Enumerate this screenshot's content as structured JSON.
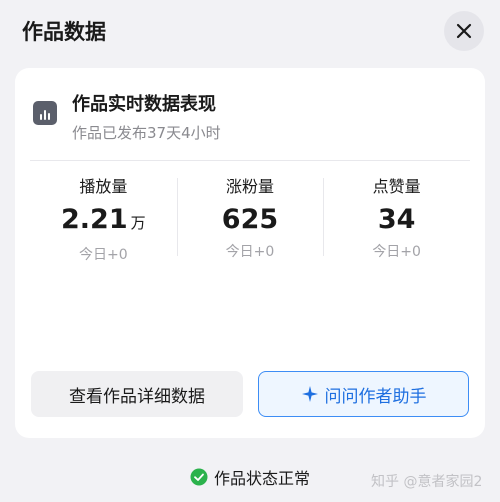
{
  "header": {
    "title": "作品数据",
    "close_icon": "close-icon"
  },
  "performance": {
    "icon": "chart-icon",
    "title": "作品实时数据表现",
    "published": "作品已发布37天4小时"
  },
  "stats": [
    {
      "label": "播放量",
      "value": "2.21",
      "unit": "万",
      "today": "今日+0"
    },
    {
      "label": "涨粉量",
      "value": "625",
      "unit": "",
      "today": "今日+0"
    },
    {
      "label": "点赞量",
      "value": "34",
      "unit": "",
      "today": "今日+0"
    }
  ],
  "actions": {
    "detail_label": "查看作品详细数据",
    "assistant_label": "问问作者助手",
    "assistant_icon": "sparkle-icon"
  },
  "status": {
    "text": "作品状态正常",
    "icon": "check-circle-icon",
    "color": "#2bb24c"
  },
  "watermark": "知乎 @意者家园2",
  "colors": {
    "accent": "#3d8df5",
    "accent_text": "#1e6fe0",
    "background": "#f2f2f5"
  }
}
